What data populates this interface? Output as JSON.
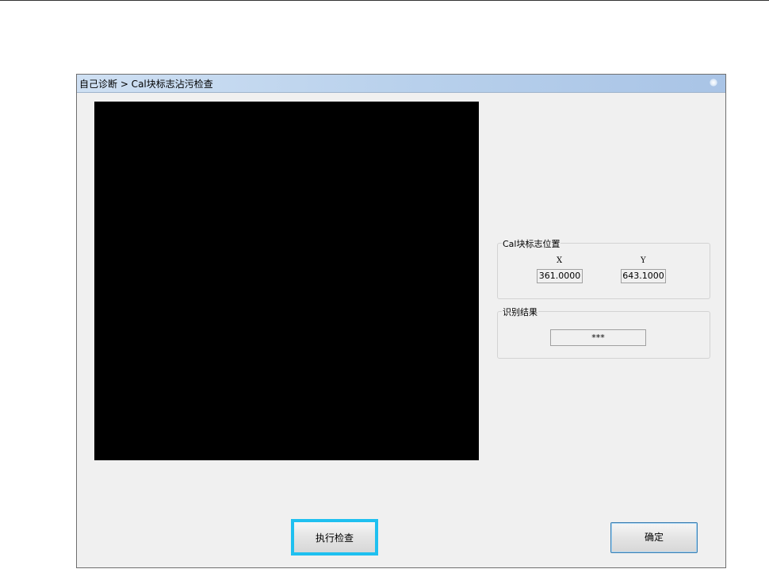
{
  "window": {
    "title": "自己诊断 > Cal块标志沾污检查"
  },
  "position_group": {
    "legend": "Cal块标志位置",
    "x_label": "X",
    "y_label": "Y",
    "x_value": "361.0000",
    "y_value": "643.1000"
  },
  "result_group": {
    "legend": "识别结果",
    "value": "***"
  },
  "buttons": {
    "execute_label": "执行检查",
    "ok_label": "确定"
  }
}
